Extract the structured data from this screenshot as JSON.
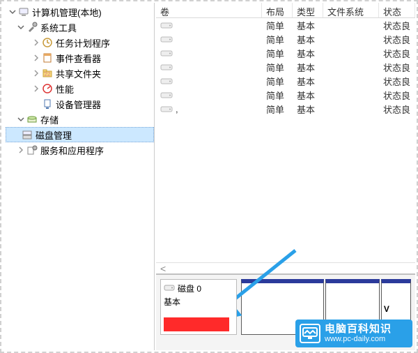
{
  "tree": {
    "root": "计算机管理(本地)",
    "system_tools": "系统工具",
    "task_scheduler": "任务计划程序",
    "event_viewer": "事件查看器",
    "shared_folders": "共享文件夹",
    "performance": "性能",
    "device_manager": "设备管理器",
    "storage": "存储",
    "disk_management": "磁盘管理",
    "services_apps": "服务和应用程序"
  },
  "volumes": {
    "headers": {
      "volume": "卷",
      "layout": "布局",
      "type": "类型",
      "fs": "文件系统",
      "status": "状态"
    },
    "rows": [
      {
        "name": "",
        "layout": "简单",
        "type": "基本",
        "fs": "",
        "status": "状态良"
      },
      {
        "name": "",
        "layout": "简单",
        "type": "基本",
        "fs": "",
        "status": "状态良"
      },
      {
        "name": "",
        "layout": "简单",
        "type": "基本",
        "fs": "",
        "status": "状态良"
      },
      {
        "name": "",
        "layout": "简单",
        "type": "基本",
        "fs": "",
        "status": "状态良"
      },
      {
        "name": "",
        "layout": "简单",
        "type": "基本",
        "fs": "",
        "status": "状态良"
      },
      {
        "name": "",
        "layout": "简单",
        "type": "基本",
        "fs": "",
        "status": "状态良"
      },
      {
        "name": ",",
        "layout": "简单",
        "type": "基本",
        "fs": "",
        "status": "状态良"
      }
    ],
    "scroll_hint": "<"
  },
  "disk": {
    "title": "磁盘 0",
    "type": "基本",
    "partitions": [
      {
        "label": ""
      },
      {
        "label": ""
      },
      {
        "label": "V"
      }
    ]
  },
  "watermark": {
    "title": "电脑百科知识",
    "url": "www.pc-daily.com"
  },
  "colors": {
    "accent_arrow": "#2aa0e8",
    "partition_stripe": "#2b3a9b",
    "redact": "#ff2a2a",
    "watermark_bg": "#2aa0e8"
  }
}
